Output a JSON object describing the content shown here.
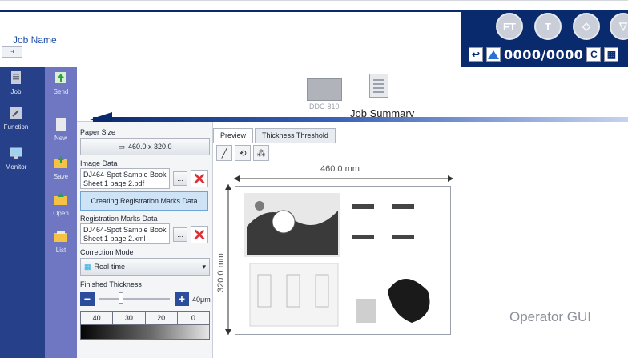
{
  "header": {
    "job_name_label": "Job Name",
    "job_icon_text": "⇢",
    "round_buttons": [
      "FT",
      "T",
      "◇",
      "▽"
    ],
    "counter": "0000/0000",
    "c_label": "C",
    "grid_icon_label": "▦"
  },
  "nav": {
    "left": [
      {
        "label": "Job",
        "icon": "document-icon"
      },
      {
        "label": "Function",
        "icon": "wrench-icon"
      },
      {
        "label": "Monitor",
        "icon": "monitor-icon"
      }
    ],
    "right": [
      {
        "label": "Send",
        "icon": "send-icon"
      },
      {
        "label": "New",
        "icon": "new-doc-icon"
      },
      {
        "label": "Save",
        "icon": "save-icon"
      },
      {
        "label": "Open",
        "icon": "open-folder-icon"
      },
      {
        "label": "List",
        "icon": "list-icon"
      }
    ]
  },
  "banner": {
    "device_label": "DDC-810",
    "job_summary": "Job Summary"
  },
  "panel": {
    "paper_size_label": "Paper Size",
    "paper_size_value": "460.0 x 320.0",
    "image_data_label": "Image Data",
    "image_file": "DJ464-Spot Sample Book Sheet 1 page 2.pdf",
    "create_reg_button": "Creating Registration Marks Data",
    "reg_data_label": "Registration Marks Data",
    "reg_file": "DJ464-Spot Sample Book Sheet 1 page 2.xml",
    "correction_mode_label": "Correction Mode",
    "correction_mode_value": "Real-time",
    "finished_thickness_label": "Finished Thickness",
    "thickness_value": "40μm",
    "thickness_scale": [
      "40",
      "30",
      "20",
      "0"
    ],
    "browse_label": "..."
  },
  "preview": {
    "tabs": [
      "Preview",
      "Thickness Threshold"
    ],
    "width_label": "460.0 mm",
    "height_label": "320.0 mm"
  },
  "footer": {
    "operator_gui": "Operator GUI"
  },
  "colors": {
    "navy": "#0a2a6e",
    "nav_left": "#26408a",
    "nav_right": "#6f76c2",
    "accent_blue": "#2a6fd4"
  }
}
